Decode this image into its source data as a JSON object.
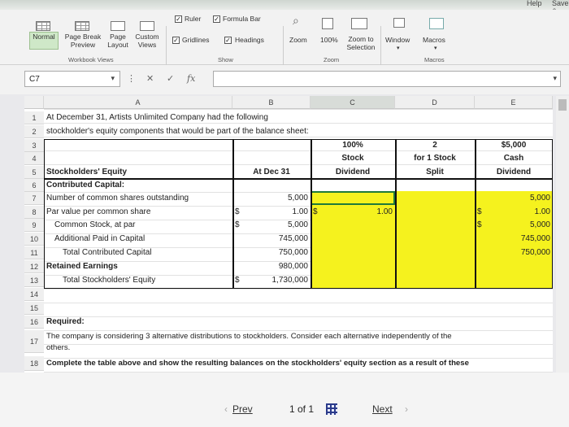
{
  "menu": {
    "help": "Help",
    "save": "Save &"
  },
  "ribbon": {
    "normal": "Normal",
    "page_break_preview": "Page Break\nPreview",
    "page_layout": "Page\nLayout",
    "custom_views": "Custom\nViews",
    "workbook_views_label": "Workbook Views",
    "ruler": "Ruler",
    "formula_bar": "Formula Bar",
    "gridlines": "Gridlines",
    "headings": "Headings",
    "show_label": "Show",
    "zoom": "Zoom",
    "zoom_100": "100%",
    "zoom_to_selection": "Zoom to\nSelection",
    "zoom_label": "Zoom",
    "window": "Window",
    "macros": "Macros",
    "macros_label": "Macros"
  },
  "formula_bar": {
    "cell_ref": "C7",
    "fx": "fx",
    "content": ""
  },
  "columns": [
    "A",
    "B",
    "C",
    "D",
    "E"
  ],
  "rows": {
    "r1": "At December 31, Artists Unlimited Company had the following",
    "r2": "stockholder's equity components that would be part of the balance sheet:",
    "c3": "100%",
    "d3": "2",
    "e3": "$5,000",
    "c4": "Stock",
    "d4": "for 1 Stock",
    "e4": "Cash",
    "a5": "Stockholders' Equity",
    "b5": "At Dec 31",
    "c5": "Dividend",
    "d5": "Split",
    "e5": "Dividend",
    "a6": "Contributed Capital:",
    "a7": "Number of common shares outstanding",
    "b7": "5,000",
    "e7": "5,000",
    "a8": "Par value per common share",
    "b8_sym": "$",
    "b8": "1.00",
    "c8_sym": "$",
    "c8": "1.00",
    "e8_sym": "$",
    "e8": "1.00",
    "a9": "Common Stock, at par",
    "b9_sym": "$",
    "b9": "5,000",
    "e9_sym": "$",
    "e9": "5,000",
    "a10": "Additional Paid in Capital",
    "b10": "745,000",
    "e10": "745,000",
    "a11": "Total Contributed Capital",
    "b11": "750,000",
    "e11": "750,000",
    "a12": "Retained Earnings",
    "b12": "980,000",
    "a13": "Total Stockholders' Equity",
    "b13_sym": "$",
    "b13": "1,730,000",
    "a16": "Required:",
    "a17": "The company is considering 3 alternative distributions to stockholders. Consider each alternative independently of the",
    "a17b": "others.",
    "a18": "Complete the table above and show the resulting balances on the stockholders' equity section as a result of these"
  },
  "row_numbers": [
    "1",
    "2",
    "3",
    "4",
    "5",
    "6",
    "7",
    "8",
    "9",
    "10",
    "11",
    "12",
    "13",
    "14",
    "15",
    "16",
    "17",
    "18"
  ],
  "pager": {
    "prev": "Prev",
    "page": "1 of 1",
    "next": "Next"
  },
  "colors": {
    "highlight": "#f5f21e",
    "normal_view": "#cfe8c8"
  }
}
